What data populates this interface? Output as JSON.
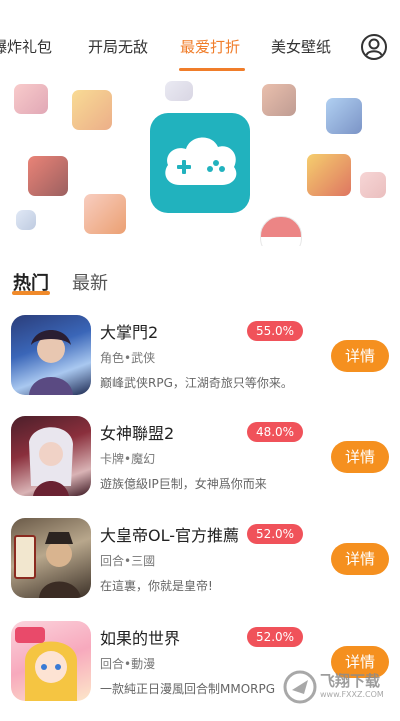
{
  "top_tabs": [
    {
      "label": "爆炸礼包"
    },
    {
      "label": "开局无敌"
    },
    {
      "label": "最爱打折"
    },
    {
      "label": "美女壁纸"
    }
  ],
  "active_tab_index": 2,
  "colors": {
    "accent": "#f07d2a",
    "button": "#f5901f",
    "badge": "#f0525a",
    "logo_bg": "#21b2be"
  },
  "section_tabs": [
    {
      "label": "热门"
    },
    {
      "label": "最新"
    }
  ],
  "games": [
    {
      "name": "大掌門2",
      "discount": "55.0%",
      "tags": "角色•武侠",
      "desc": "巅峰武侠RPG，江湖奇旅只等你来。",
      "button": "详情"
    },
    {
      "name": "女神聯盟2",
      "discount": "48.0%",
      "tags": "卡牌•魔幻",
      "desc": "遊族億級IP巨制，女神爲你而来",
      "button": "详情"
    },
    {
      "name": "大皇帝OL-官方推薦",
      "discount": "52.0%",
      "tags": "回合•三國",
      "desc": "在這裏，你就是皇帝!",
      "button": "详情"
    },
    {
      "name": "如果的世界",
      "discount": "52.0%",
      "tags": "回合•動漫",
      "desc": "一款純正日漫風回合制MMORPG",
      "button": "详情"
    }
  ],
  "watermark": {
    "text": "飞翔下载",
    "sub": "www.FXXZ.COM"
  }
}
